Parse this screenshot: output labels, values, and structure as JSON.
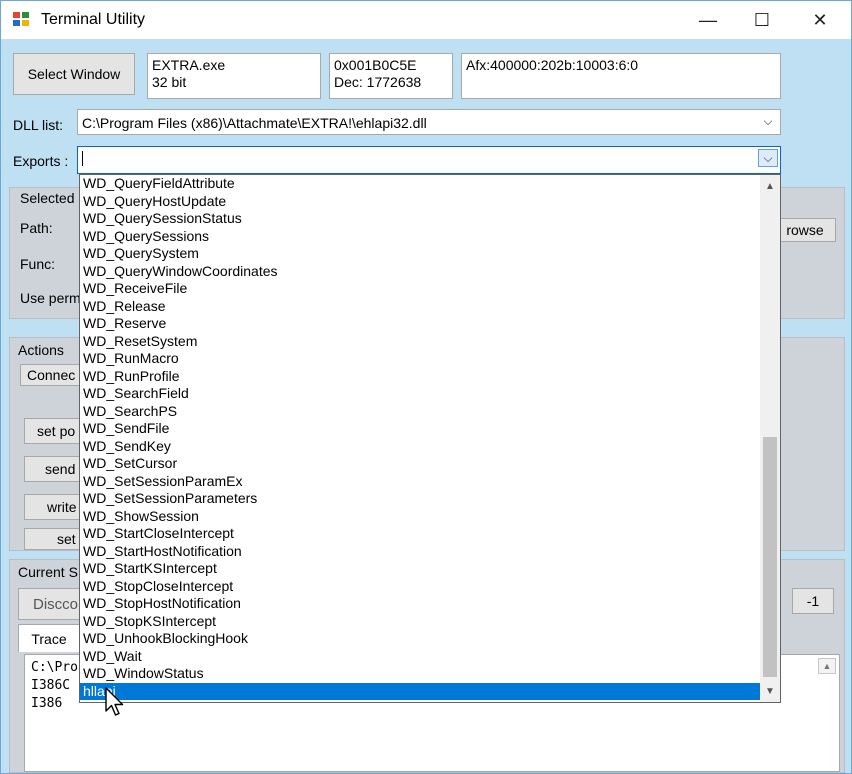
{
  "window": {
    "title": "Terminal Utility"
  },
  "controls": {
    "minimize": "—",
    "maximize": "☐",
    "close": "✕"
  },
  "top_row": {
    "select_window_label": "Select Window",
    "process_info": "EXTRA.exe\n32 bit",
    "handle_info": "0x001B0C5E\nDec: 1772638",
    "class_info": "Afx:400000:202b:10003:6:0"
  },
  "dll": {
    "label": "DLL list:",
    "value": "C:\\Program Files (x86)\\Attachmate\\EXTRA!\\ehlapi32.dll"
  },
  "exports": {
    "label": "Exports :",
    "value": ""
  },
  "selected_group": {
    "title": "Selected",
    "path_label": "Path:",
    "func_label": "Func:",
    "use_perm_label": "Use perm",
    "browse_label": "rowse"
  },
  "actions_group": {
    "title": "Actions",
    "connect_label": "Connec",
    "set_pos_label": "set po",
    "send_label": "send",
    "write_label": "write",
    "set_label": "set"
  },
  "current_group": {
    "title": "Current S",
    "status_value": "Discco",
    "right_value": "-1"
  },
  "trace": {
    "tab_label": "Trace",
    "lines": [
      "C:\\Pro",
      "I386C",
      "I386"
    ]
  },
  "export_options": [
    "WD_QueryFieldAttribute",
    "WD_QueryHostUpdate",
    "WD_QuerySessionStatus",
    "WD_QuerySessions",
    "WD_QuerySystem",
    "WD_QueryWindowCoordinates",
    "WD_ReceiveFile",
    "WD_Release",
    "WD_Reserve",
    "WD_ResetSystem",
    "WD_RunMacro",
    "WD_RunProfile",
    "WD_SearchField",
    "WD_SearchPS",
    "WD_SendFile",
    "WD_SendKey",
    "WD_SetCursor",
    "WD_SetSessionParamEx",
    "WD_SetSessionParameters",
    "WD_ShowSession",
    "WD_StartCloseIntercept",
    "WD_StartHostNotification",
    "WD_StartKSIntercept",
    "WD_StopCloseIntercept",
    "WD_StopHostNotification",
    "WD_StopKSIntercept",
    "WD_UnhookBlockingHook",
    "WD_Wait",
    "WD_WindowStatus",
    "hllapi"
  ],
  "selected_export_index": 29,
  "icons": {
    "app": "app-icon",
    "dropdown": "chevron-down-icon",
    "scroll_up": "chevron-up-icon",
    "scroll_down": "chevron-down-icon",
    "pointer": "mouse-cursor-icon"
  },
  "colors": {
    "window_bg": "#bfe0f3",
    "group_bg": "#cdd3d9",
    "selection": "#0078d7"
  }
}
